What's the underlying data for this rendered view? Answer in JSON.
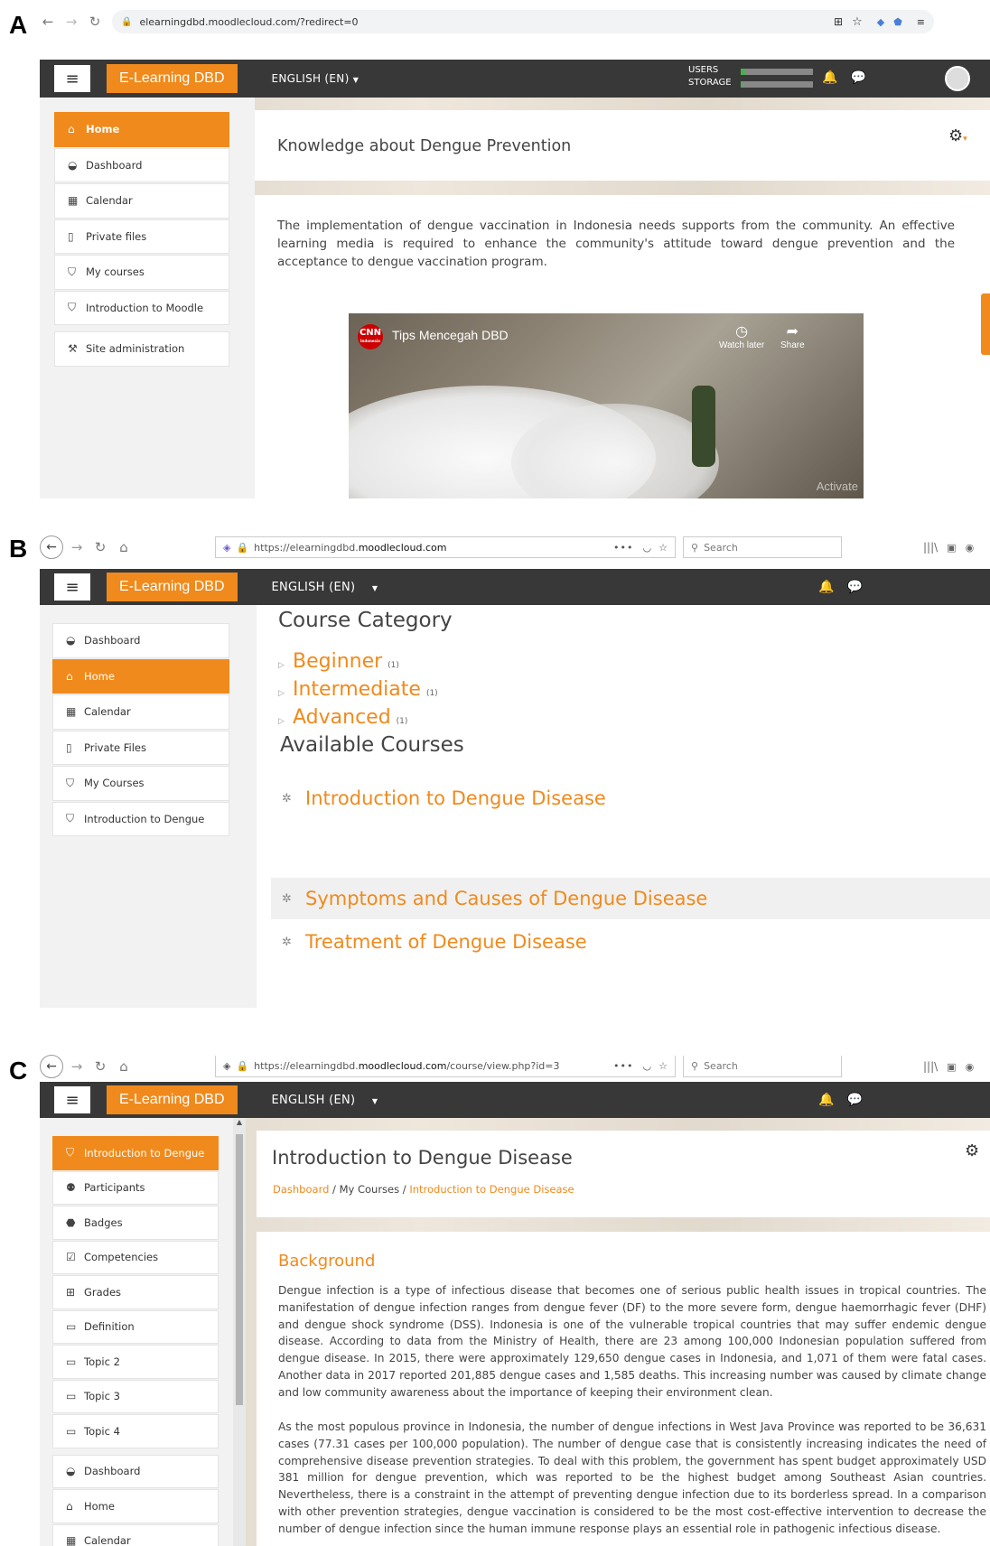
{
  "panelA": {
    "label": "A",
    "url": "elearningdbd.moodlecloud.com/?redirect=0",
    "brand": "E-Learning DBD",
    "language": "ENGLISH (EN)",
    "users_label": "USERS",
    "storage_label": "STORAGE",
    "sidebar": [
      {
        "label": "Home",
        "icon": "home-icon"
      },
      {
        "label": "Dashboard",
        "icon": "dashboard-icon"
      },
      {
        "label": "Calendar",
        "icon": "calendar-icon"
      },
      {
        "label": "Private files",
        "icon": "file-icon"
      },
      {
        "label": "My courses",
        "icon": "graduation-cap-icon"
      },
      {
        "label": "Introduction to Moodle",
        "icon": "graduation-cap-icon"
      },
      {
        "label": "Site administration",
        "icon": "wrench-icon"
      }
    ],
    "title": "Knowledge about Dengue Prevention",
    "body": "The implementation of dengue vaccination in Indonesia needs supports from the community. An effective learning media is required to enhance the community's attitude toward dengue prevention and the acceptance to dengue vaccination program.",
    "video": {
      "channel": "CNN",
      "channel_sub": "Indonesia",
      "title": "Tips Mencegah DBD",
      "watch_later": "Watch later",
      "share": "Share",
      "watermark": "Activate"
    }
  },
  "panelB": {
    "label": "B",
    "url_prefix": "https://elearningdbd.",
    "url_domain": "moodlecloud.com",
    "search_placeholder": "Search",
    "brand": "E-Learning DBD",
    "language": "ENGLISH (EN)",
    "sidebar": [
      {
        "label": "Dashboard",
        "icon": "dashboard-icon"
      },
      {
        "label": "Home",
        "icon": "home-icon"
      },
      {
        "label": "Calendar",
        "icon": "calendar-icon"
      },
      {
        "label": "Private Files",
        "icon": "file-icon"
      },
      {
        "label": "My Courses",
        "icon": "graduation-cap-icon"
      },
      {
        "label": "Introduction to Dengue",
        "icon": "graduation-cap-icon"
      }
    ],
    "category_heading": "Course Category",
    "categories": [
      {
        "name": "Beginner",
        "count": "(1)"
      },
      {
        "name": "Intermediate",
        "count": "(1)"
      },
      {
        "name": "Advanced",
        "count": "(1)"
      }
    ],
    "courses_heading": "Available Courses",
    "courses": [
      "Introduction to Dengue Disease",
      "Symptoms and Causes of Dengue Disease",
      "Treatment of  Dengue Disease"
    ]
  },
  "panelC": {
    "label": "C",
    "url_prefix": "https://elearningdbd.",
    "url_domain": "moodlecloud.com",
    "url_path": "/course/view.php?id=3",
    "search_placeholder": "Search",
    "brand": "E-Learning DBD",
    "language": "ENGLISH (EN)",
    "sidebar": [
      {
        "label": "Introduction to Dengue",
        "icon": "graduation-cap-icon"
      },
      {
        "label": "Participants",
        "icon": "users-icon"
      },
      {
        "label": "Badges",
        "icon": "shield-icon"
      },
      {
        "label": "Competencies",
        "icon": "checkbox-icon"
      },
      {
        "label": "Grades",
        "icon": "table-icon"
      },
      {
        "label": "Definition",
        "icon": "folder-icon"
      },
      {
        "label": "Topic 2",
        "icon": "folder-icon"
      },
      {
        "label": "Topic 3",
        "icon": "folder-icon"
      },
      {
        "label": "Topic 4",
        "icon": "folder-icon"
      },
      {
        "label": "Dashboard",
        "icon": "dashboard-icon"
      },
      {
        "label": "Home",
        "icon": "home-icon"
      },
      {
        "label": "Calendar",
        "icon": "calendar-icon"
      }
    ],
    "title": "Introduction to Dengue Disease",
    "breadcrumb": {
      "b1": "Dashboard",
      "sep1": " / ",
      "b2": "My Courses",
      "sep2": " / ",
      "b3": "Introduction to Dengue Disease"
    },
    "section_title": "Background",
    "paragraph1": "Dengue infection is a type of infectious disease that becomes one of serious public health issues in tropical countries. The manifestation of dengue infection ranges from dengue fever (DF) to the more severe form, dengue haemorrhagic fever (DHF) and dengue shock syndrome (DSS). Indonesia is one of the vulnerable tropical countries that may suffer endemic dengue disease. According to data from the Ministry of Health, there are 23 among 100,000 Indonesian population suffered from dengue disease. In 2015, there were approximately 129,650 dengue cases in Indonesia, and 1,071 of them were fatal cases. Another data in 2017 reported 201,885 dengue cases and 1,585 deaths. This increasing number was caused by climate change and low community awareness about the importance of keeping their environment clean.",
    "paragraph2": "As the most populous province in Indonesia, the number of dengue infections in West Java Province was reported to be 36,631 cases (77.31 cases per 100,000 population). The number of dengue case that is consistently increasing indicates the need of comprehensive disease prevention strategies. To deal with this problem, the government has spent budget approximately USD 381 million for dengue prevention, which was reported to be the highest budget among Southeast Asian countries. Nevertheless, there is a constraint in the attempt of preventing dengue infection due to its borderless spread. In a comparison with other prevention strategies, dengue vaccination is considered to be the most cost-effective intervention to decrease the number of dengue infection since the human immune response plays an essential role in pathogenic infectious disease."
  },
  "colors": {
    "accent": "#f08a1c",
    "navbar": "#383838"
  }
}
